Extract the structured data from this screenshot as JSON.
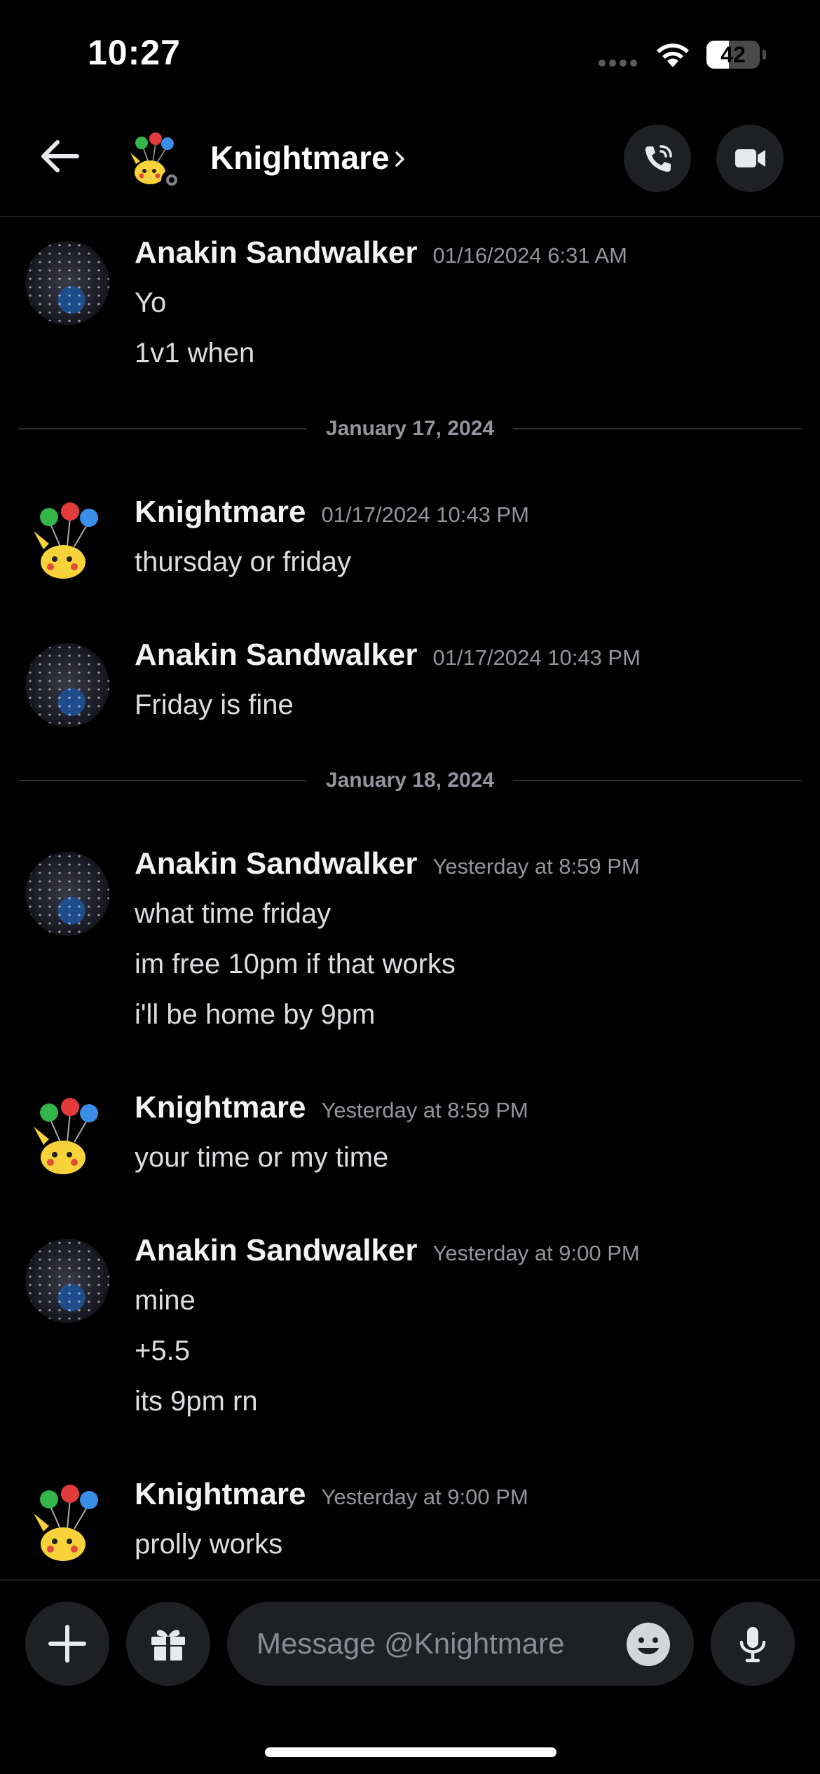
{
  "status_bar": {
    "time": "10:27",
    "battery_percent": "42",
    "battery_level": 0.42
  },
  "header": {
    "title": "Knightmare",
    "back_icon": "arrow-left-icon",
    "call_icon": "phone-call-icon",
    "video_icon": "video-camera-icon"
  },
  "messages": [
    {
      "author": "Anakin Sandwalker",
      "timestamp": "01/16/2024 6:31 AM",
      "avatar": "night-sky-avatar",
      "lines": [
        "Yo",
        "1v1 when"
      ]
    },
    {
      "author": "Knightmare",
      "timestamp": "01/17/2024 10:43 PM",
      "avatar": "pikachu-balloons-avatar",
      "lines": [
        "thursday or friday"
      ]
    },
    {
      "author": "Anakin Sandwalker",
      "timestamp": "01/17/2024 10:43 PM",
      "avatar": "night-sky-avatar",
      "lines": [
        "Friday is fine"
      ]
    },
    {
      "author": "Anakin Sandwalker",
      "timestamp": "Yesterday at 8:59 PM",
      "avatar": "night-sky-avatar",
      "lines": [
        "what time friday",
        "im free 10pm if that works",
        "i'll be home by 9pm"
      ]
    },
    {
      "author": "Knightmare",
      "timestamp": "Yesterday at 8:59 PM",
      "avatar": "pikachu-balloons-avatar",
      "lines": [
        "your time or my time"
      ]
    },
    {
      "author": "Anakin Sandwalker",
      "timestamp": "Yesterday at 9:00 PM",
      "avatar": "night-sky-avatar",
      "lines": [
        "mine",
        "+5.5",
        "its 9pm rn"
      ]
    },
    {
      "author": "Knightmare",
      "timestamp": "Yesterday at 9:00 PM",
      "avatar": "pikachu-balloons-avatar",
      "lines": [
        "prolly works"
      ]
    }
  ],
  "date_dividers": [
    "January 17, 2024",
    "January 18, 2024"
  ],
  "composer": {
    "placeholder": "Message @Knightmare",
    "icons": [
      "plus-icon",
      "gift-icon",
      "emoji-icon",
      "microphone-icon"
    ]
  }
}
